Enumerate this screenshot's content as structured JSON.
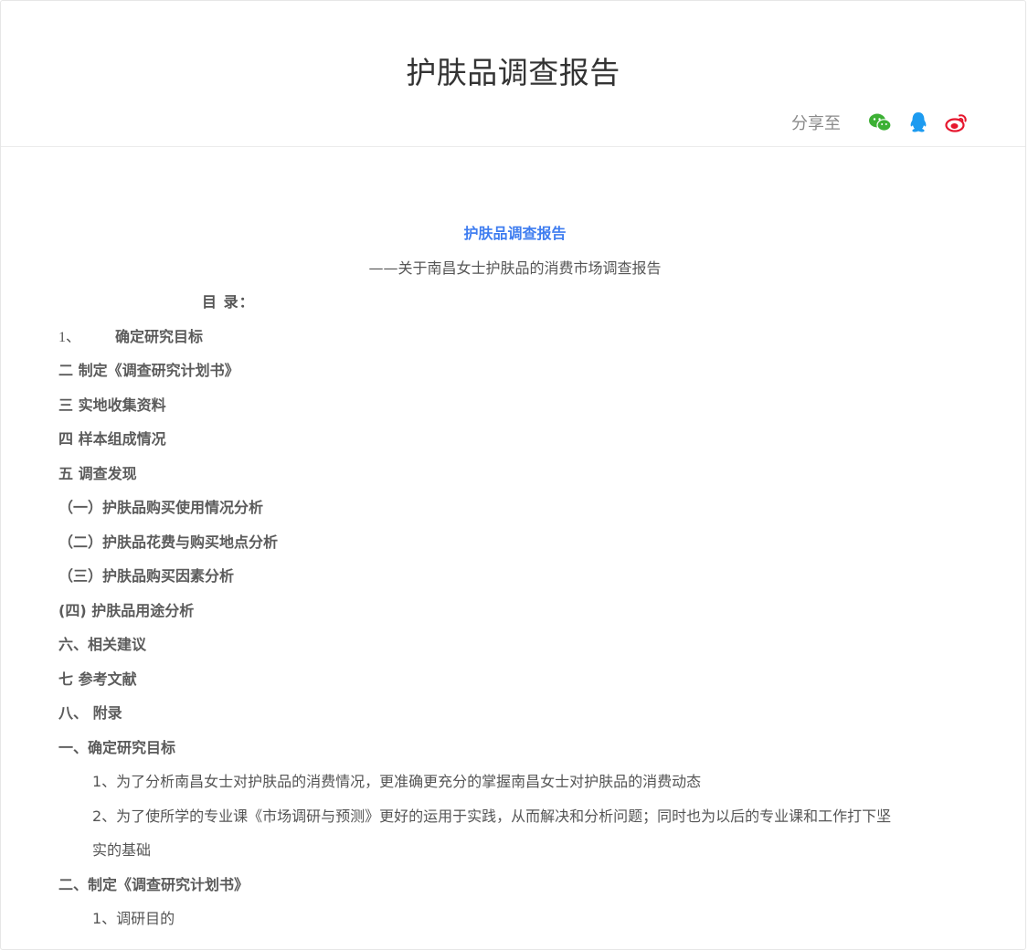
{
  "header": {
    "title": "护肤品调查报告",
    "share_label": "分享至",
    "share_icons": [
      "wechat-icon",
      "qq-icon",
      "weibo-icon"
    ]
  },
  "colors": {
    "doc_title": "#3f7df0",
    "wechat": "#3cb034",
    "qq": "#1d9bf0",
    "weibo": "#e6162d"
  },
  "document": {
    "title": "护肤品调查报告",
    "subtitle": "——关于南昌女士护肤品的消费市场调查报告",
    "toc_heading": "目 录：",
    "toc": {
      "item1_num": "1、",
      "item1_text": "确定研究目标",
      "items": [
        "二 制定《调查研究计划书》",
        "三 实地收集资料",
        "四 样本组成情况",
        "五 调查发现",
        "（一）护肤品购买使用情况分析",
        "（二）护肤品花费与购买地点分析",
        "（三）护肤品购买因素分析",
        "(四) 护肤品用途分析",
        "六、相关建议",
        "七 参考文献",
        "八、 附录"
      ]
    },
    "section1": {
      "heading": "一、确定研究目标",
      "p1": "1、为了分析南昌女士对护肤品的消费情况，更准确更充分的掌握南昌女士对护肤品的消费动态",
      "p2_line1": "2、为了使所学的专业课《市场调研与预测》更好的运用于实践，从而解决和分析问题；同时也为以后的专业课和工作打下坚",
      "p2_line2": "实的基础"
    },
    "section2": {
      "heading": "二、制定《调查研究计划书》",
      "next_line": "1、调研目的"
    }
  }
}
